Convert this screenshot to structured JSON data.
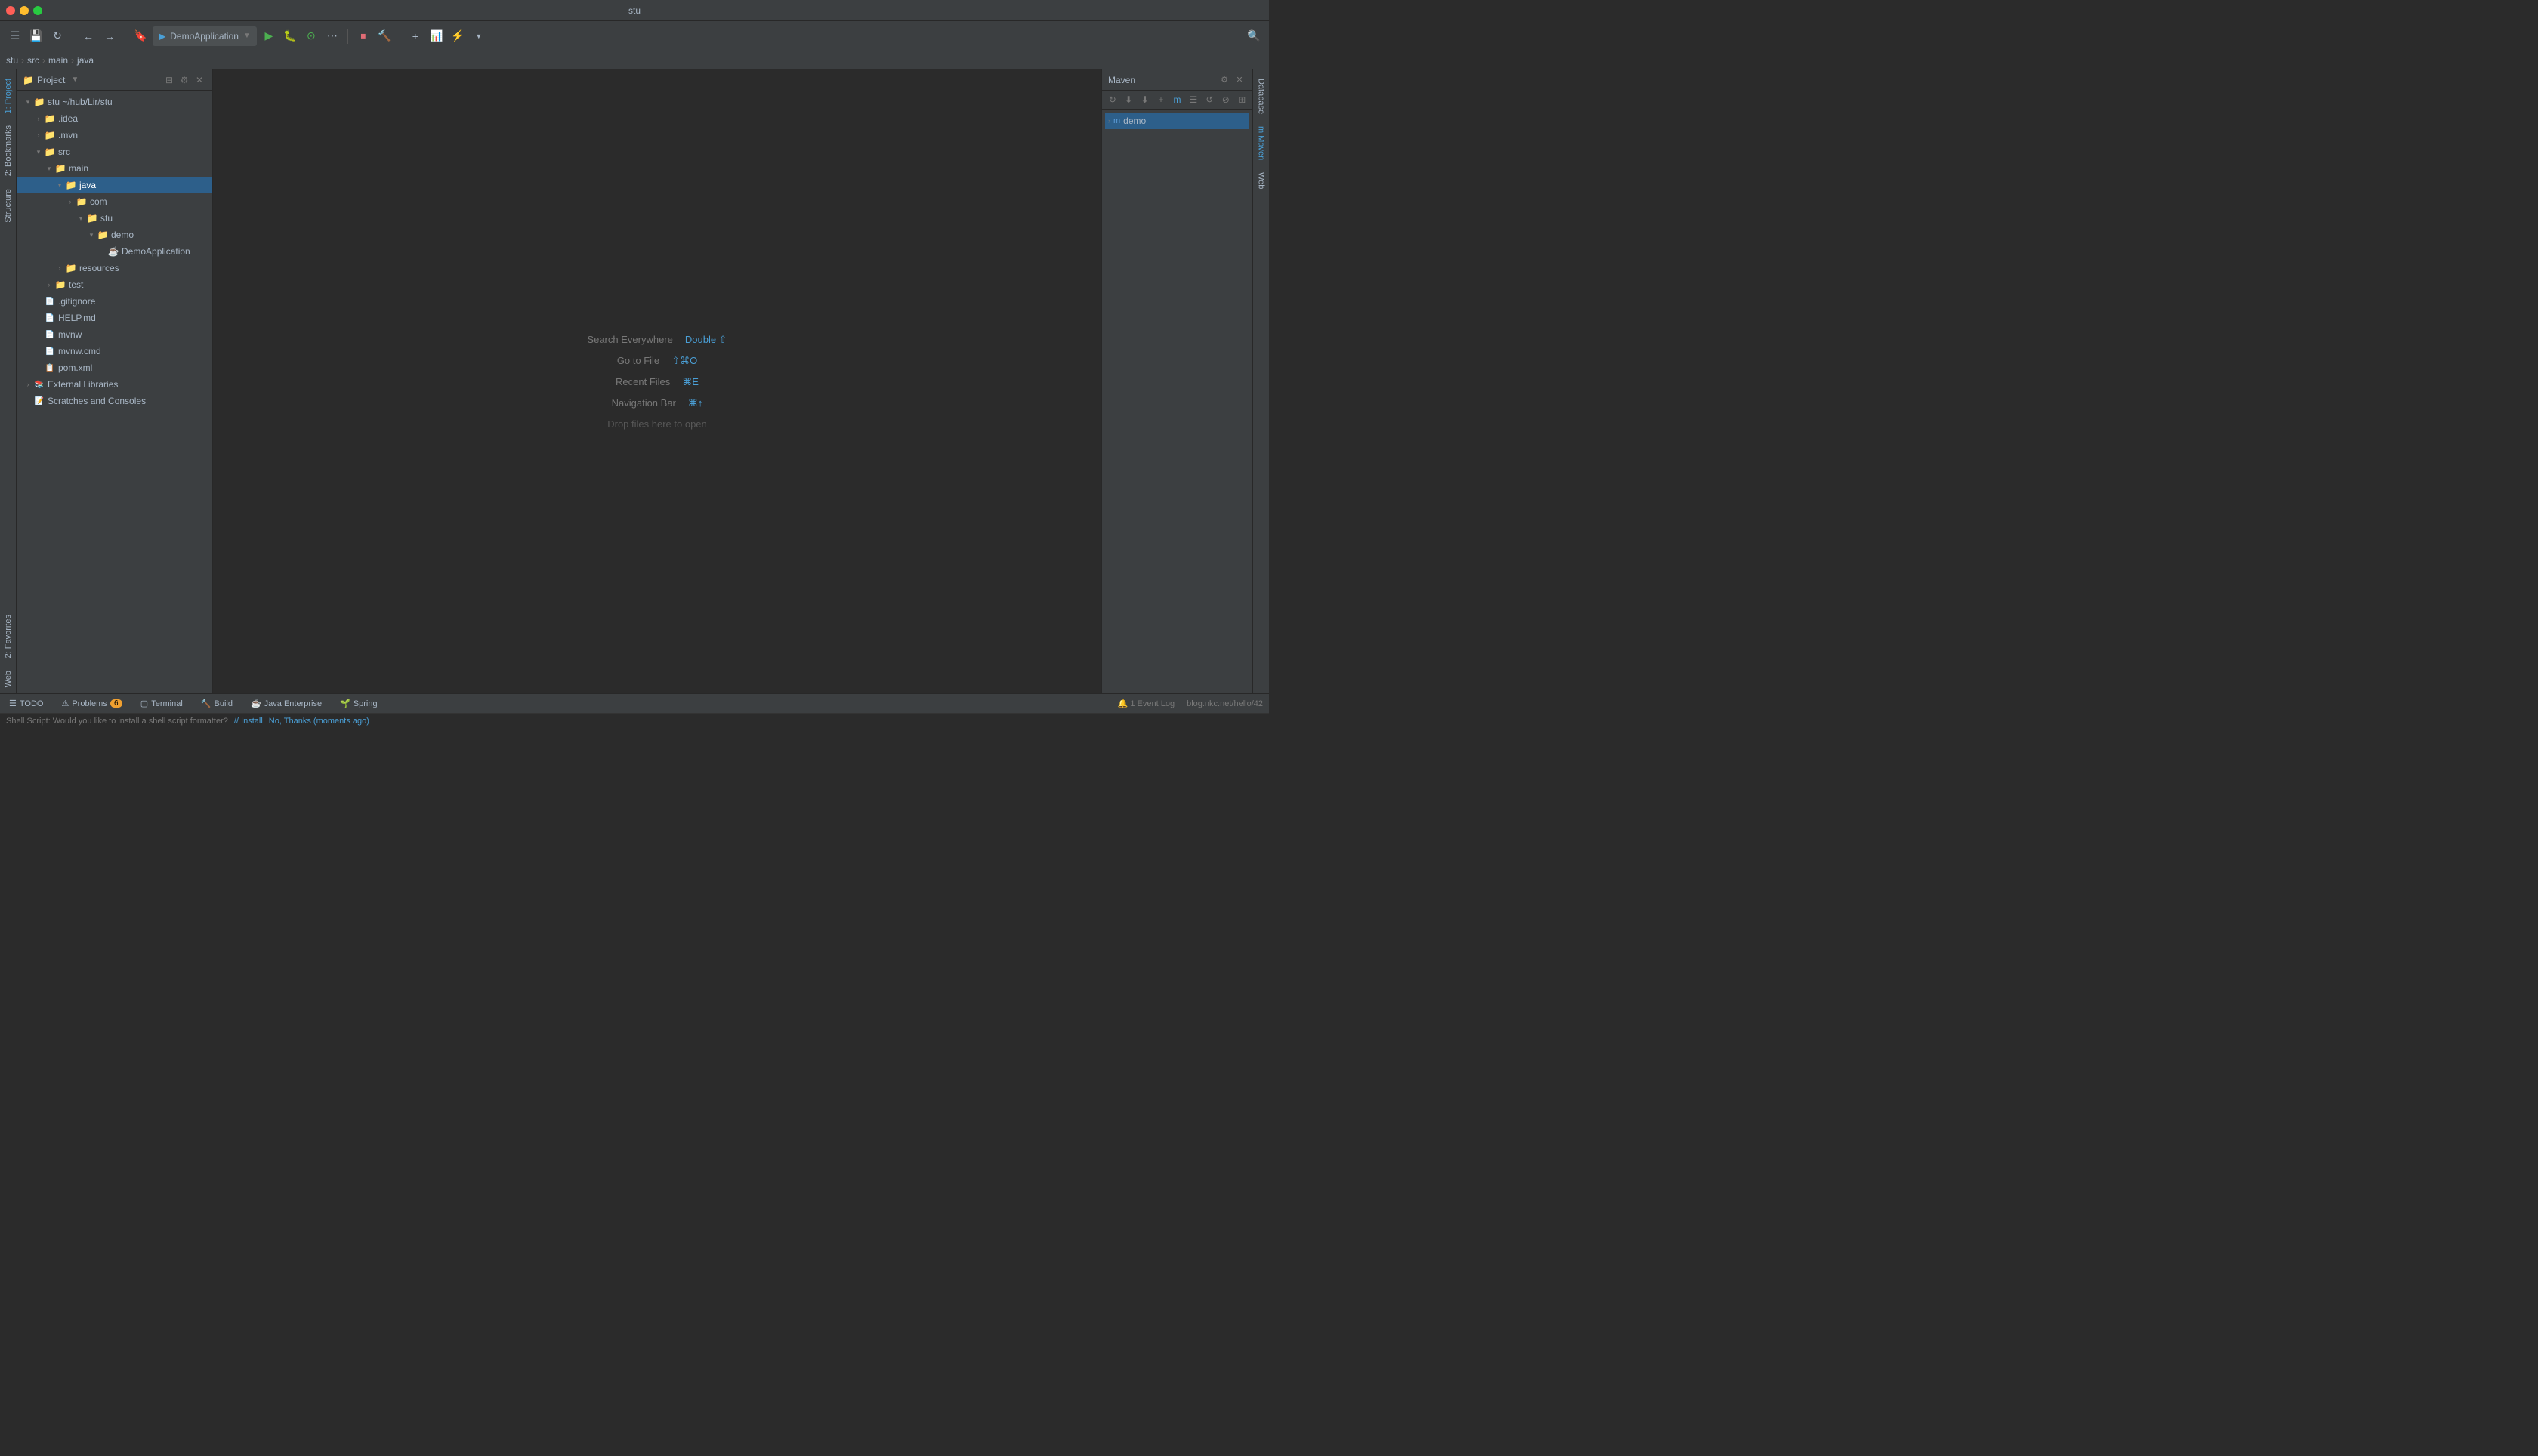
{
  "window": {
    "title": "stu"
  },
  "title_bar": {
    "title": "stu",
    "traffic_lights": [
      "red",
      "yellow",
      "green"
    ]
  },
  "toolbar": {
    "run_config": "DemoApplication",
    "buttons": [
      "menu",
      "save",
      "sync",
      "back",
      "forward",
      "bookmark",
      "run_config_dropdown",
      "run",
      "debug",
      "coverage",
      "run_with",
      "stop",
      "build_menu",
      "add_config",
      "coverage2",
      "profiler_menu",
      "search"
    ]
  },
  "breadcrumb": {
    "items": [
      "stu",
      "src",
      "main",
      "java"
    ]
  },
  "left_tabs": [
    {
      "id": "project",
      "label": "1: Project",
      "number": "1",
      "active": true
    },
    {
      "id": "bookmarks",
      "label": "2: Bookmarks",
      "number": "2",
      "active": false
    },
    {
      "id": "structure",
      "label": "Structure",
      "number": "",
      "active": false
    },
    {
      "id": "favorites",
      "label": "2: Favorites",
      "number": "",
      "active": false
    },
    {
      "id": "web",
      "label": "Web",
      "number": "",
      "active": false
    }
  ],
  "sidebar": {
    "title": "Project",
    "tree": [
      {
        "id": "stu-root",
        "label": "stu ~/hub/Lir/stu",
        "indent": 0,
        "arrow": "▾",
        "icon": "folder",
        "color": "#d4af37",
        "expanded": true
      },
      {
        "id": "idea",
        "label": ".idea",
        "indent": 1,
        "arrow": "›",
        "icon": "folder",
        "color": "#d4af37",
        "expanded": false
      },
      {
        "id": "mvn",
        "label": ".mvn",
        "indent": 1,
        "arrow": "›",
        "icon": "folder",
        "color": "#d4af37",
        "expanded": false
      },
      {
        "id": "src",
        "label": "src",
        "indent": 1,
        "arrow": "▾",
        "icon": "folder",
        "color": "#d4af37",
        "expanded": true
      },
      {
        "id": "main",
        "label": "main",
        "indent": 2,
        "arrow": "▾",
        "icon": "folder",
        "color": "#d4af37",
        "expanded": true
      },
      {
        "id": "java",
        "label": "java",
        "indent": 3,
        "arrow": "▾",
        "icon": "folder",
        "color": "#5c9bd6",
        "expanded": true,
        "selected": true
      },
      {
        "id": "com",
        "label": "com",
        "indent": 4,
        "arrow": "›",
        "icon": "folder",
        "color": "#d4af37",
        "expanded": false
      },
      {
        "id": "stu-pkg",
        "label": "stu",
        "indent": 5,
        "arrow": "▾",
        "icon": "folder",
        "color": "#d4af37",
        "expanded": true
      },
      {
        "id": "demo-pkg",
        "label": "demo",
        "indent": 6,
        "arrow": "▾",
        "icon": "folder",
        "color": "#d4af37",
        "expanded": true
      },
      {
        "id": "DemoApplication",
        "label": "DemoApplication",
        "indent": 7,
        "arrow": "",
        "icon": "java",
        "color": "#cc7832",
        "expanded": false
      },
      {
        "id": "resources",
        "label": "resources",
        "indent": 3,
        "arrow": "›",
        "icon": "folder",
        "color": "#d4af37",
        "expanded": false
      },
      {
        "id": "test",
        "label": "test",
        "indent": 2,
        "arrow": "›",
        "icon": "folder",
        "color": "#d4af37",
        "expanded": false
      },
      {
        "id": "gitignore",
        "label": ".gitignore",
        "indent": 1,
        "arrow": "",
        "icon": "file",
        "color": "#a9b7c6",
        "expanded": false
      },
      {
        "id": "HELP",
        "label": "HELP.md",
        "indent": 1,
        "arrow": "",
        "icon": "file",
        "color": "#a9b7c6",
        "expanded": false
      },
      {
        "id": "mvnw",
        "label": "mvnw",
        "indent": 1,
        "arrow": "",
        "icon": "file",
        "color": "#a9b7c6",
        "expanded": false
      },
      {
        "id": "mvnw-cmd",
        "label": "mvnw.cmd",
        "indent": 1,
        "arrow": "",
        "icon": "file",
        "color": "#a9b7c6",
        "expanded": false
      },
      {
        "id": "pom",
        "label": "pom.xml",
        "indent": 1,
        "arrow": "",
        "icon": "xml",
        "color": "#e06c75",
        "expanded": false
      },
      {
        "id": "external-libs",
        "label": "External Libraries",
        "indent": 0,
        "arrow": "›",
        "icon": "libs",
        "color": "#a9b7c6",
        "expanded": false
      },
      {
        "id": "scratches",
        "label": "Scratches and Consoles",
        "indent": 0,
        "arrow": "",
        "icon": "scratches",
        "color": "#a9b7c6",
        "expanded": false
      }
    ]
  },
  "editor": {
    "hints": [
      {
        "label": "Search Everywhere",
        "key": "Double ⇧"
      },
      {
        "label": "Go to File",
        "key": "⇧⌘O"
      },
      {
        "label": "Recent Files",
        "key": "⌘E"
      },
      {
        "label": "Navigation Bar",
        "key": "⌘↑"
      },
      {
        "label": "Drop files here to open",
        "key": ""
      }
    ]
  },
  "maven_panel": {
    "title": "Maven",
    "items": [
      {
        "id": "demo",
        "label": "demo",
        "icon": "maven",
        "selected": true,
        "expanded": false
      }
    ]
  },
  "right_tabs": [
    {
      "label": "Database"
    },
    {
      "label": "m Maven"
    },
    {
      "label": "Web"
    }
  ],
  "status_bar": {
    "tabs": [
      {
        "label": "TODO",
        "icon": "☰",
        "number": null
      },
      {
        "label": "Problems",
        "icon": "⚠",
        "number": "6"
      },
      {
        "label": "Terminal",
        "icon": "▢"
      },
      {
        "label": "Build",
        "icon": "🔨"
      },
      {
        "label": "Java Enterprise",
        "icon": "☕"
      },
      {
        "label": "Spring",
        "icon": "🌱"
      }
    ],
    "right": {
      "event_log": "1 Event Log",
      "git": "blog.nkc.net/hello/42"
    }
  },
  "notification_bar": {
    "message": "Shell Script: Would you like to install a shell script formatter?",
    "install_label": "// Install",
    "dismiss_label": "No, Thanks",
    "time": "moments ago"
  }
}
